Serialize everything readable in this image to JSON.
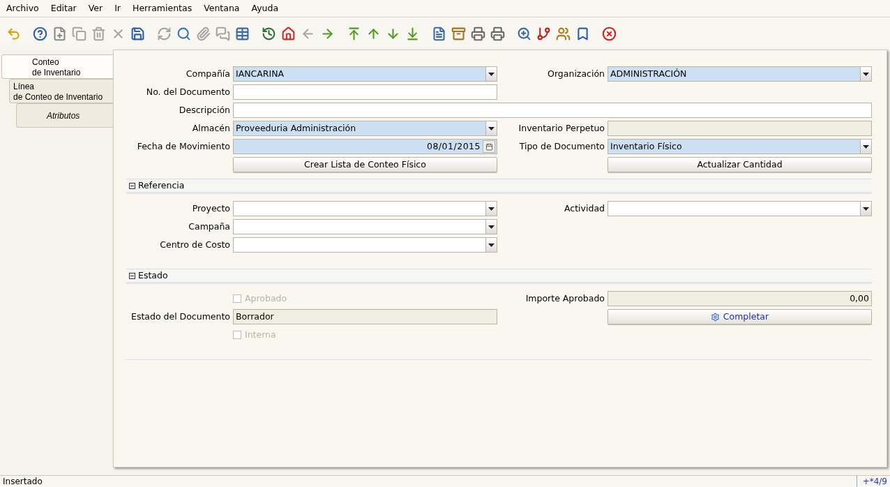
{
  "menu": [
    {
      "label": "Archivo"
    },
    {
      "label": "Editar"
    },
    {
      "label": "Ver"
    },
    {
      "label": "Ir"
    },
    {
      "label": "Herramientas"
    },
    {
      "label": "Ventana"
    },
    {
      "label": "Ayuda"
    }
  ],
  "toolbar": [
    [
      {
        "kind": "undo",
        "disabled": false
      }
    ],
    [
      {
        "kind": "help",
        "disabled": false
      },
      {
        "kind": "new",
        "disabled": false
      },
      {
        "kind": "copy",
        "disabled": true
      },
      {
        "kind": "delete",
        "disabled": true
      },
      {
        "kind": "delete-selection",
        "disabled": true
      },
      {
        "kind": "save",
        "disabled": false
      }
    ],
    [
      {
        "kind": "refresh",
        "disabled": true
      },
      {
        "kind": "find",
        "disabled": false
      },
      {
        "kind": "attachment",
        "disabled": true
      },
      {
        "kind": "chat",
        "disabled": true
      },
      {
        "kind": "grid",
        "disabled": false
      }
    ],
    [
      {
        "kind": "history",
        "disabled": false
      },
      {
        "kind": "home",
        "disabled": false
      },
      {
        "kind": "back",
        "disabled": true
      },
      {
        "kind": "forward",
        "disabled": false
      }
    ],
    [
      {
        "kind": "first",
        "disabled": false
      },
      {
        "kind": "previous",
        "disabled": false
      },
      {
        "kind": "next",
        "disabled": false
      },
      {
        "kind": "last",
        "disabled": false
      }
    ],
    [
      {
        "kind": "report",
        "disabled": false
      },
      {
        "kind": "archive",
        "disabled": false
      },
      {
        "kind": "print-preview",
        "disabled": false
      },
      {
        "kind": "print",
        "disabled": false
      }
    ],
    [
      {
        "kind": "zoom-across",
        "disabled": false
      },
      {
        "kind": "workflow",
        "disabled": false
      },
      {
        "kind": "request",
        "disabled": false
      },
      {
        "kind": "product",
        "disabled": false
      }
    ],
    [
      {
        "kind": "close",
        "disabled": false
      }
    ]
  ],
  "tabs": [
    {
      "label": "Conteo\nde Inventario",
      "selected": true,
      "disabled": false,
      "children": [
        {
          "label": "Línea\nde Conteo de Inventario",
          "selected": false,
          "disabled": false,
          "children": [
            {
              "label": "Atributos",
              "selected": false,
              "disabled": true
            }
          ]
        }
      ]
    }
  ],
  "header_rows": [
    {
      "left": {
        "kind": "combo",
        "label": "Compañía",
        "value": "IANCARINA",
        "mandatory": true
      },
      "right": {
        "kind": "combo",
        "label": "Organización",
        "value": "ADMINISTRACIÓN",
        "mandatory": true
      }
    },
    {
      "left": {
        "kind": "text",
        "label": "No. del Documento"
      }
    },
    {
      "wide": {
        "kind": "text",
        "label": "Descripción"
      }
    },
    {
      "left": {
        "kind": "combo",
        "label": "Almacén",
        "value": "Proveeduria Administración",
        "mandatory": true
      },
      "right": {
        "kind": "readonly",
        "label": "Inventario Perpetuo"
      }
    },
    {
      "left": {
        "kind": "date",
        "label": "Fecha de Movimiento",
        "value": "08/01/2015"
      },
      "right": {
        "kind": "combo",
        "label": "Tipo de Documento",
        "value": "Inventario Físico",
        "mandatory": true
      }
    },
    {
      "left": {
        "kind": "button",
        "label": "Crear Lista de Conteo Físico"
      },
      "right": {
        "kind": "button",
        "label": "Actualizar Cantidad"
      }
    }
  ],
  "sections": [
    {
      "title": "Referencia",
      "expanded": true,
      "rows": [
        {
          "left": {
            "kind": "combo",
            "label": "Proyecto",
            "mandatory": false
          },
          "right": {
            "kind": "combo",
            "label": "Actividad",
            "mandatory": false
          }
        },
        {
          "left": {
            "kind": "combo",
            "label": "Campaña",
            "mandatory": false
          }
        },
        {
          "left": {
            "kind": "combo",
            "label": "Centro de Costo",
            "mandatory": false
          }
        }
      ]
    },
    {
      "title": "Estado",
      "expanded": true,
      "rows": [
        {
          "left": {
            "kind": "checkbox",
            "label": "Aprobado",
            "checked": false,
            "disabled": true
          },
          "right": {
            "kind": "readonly-number",
            "label": "Importe Aprobado",
            "value": "0,00"
          }
        },
        {
          "left": {
            "kind": "readonly",
            "label": "Estado del Documento",
            "value": "Borrador"
          },
          "right": {
            "kind": "process",
            "label": "Completar"
          }
        },
        {
          "left": {
            "kind": "checkbox",
            "label": "Interna",
            "checked": false,
            "disabled": true
          }
        }
      ]
    }
  ],
  "status_bar": {
    "message": "Insertado",
    "record": "+*4/9"
  }
}
